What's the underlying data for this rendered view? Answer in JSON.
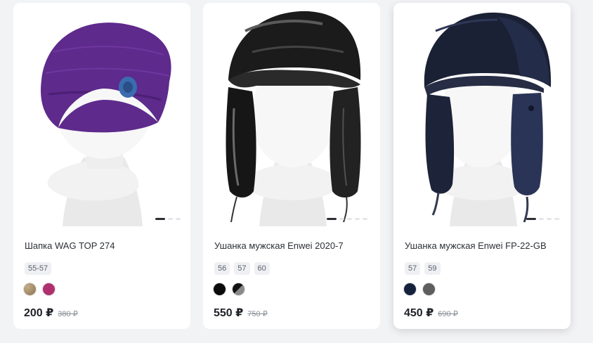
{
  "products": [
    {
      "title": "Шапка WAG TOP 274",
      "sizes": [
        "55-57"
      ],
      "colors": [
        "#a08a66",
        "#b0306e"
      ],
      "price": "200 ₽",
      "old_price": "380 ₽",
      "image_icon": "purple-beanie-icon",
      "slides": 3,
      "active_slide": 1
    },
    {
      "title": "Ушанка мужская Enwei 2020-7",
      "sizes": [
        "56",
        "57",
        "60"
      ],
      "colors": [
        "#0b0b0b",
        "#6e6e6e"
      ],
      "price": "550 ₽",
      "old_price": "750 ₽",
      "image_icon": "black-fur-ushanka-icon",
      "slides": 5,
      "active_slide": 1
    },
    {
      "title": "Ушанка мужская Enwei FP-22-GB",
      "sizes": [
        "57",
        "59"
      ],
      "colors": [
        "#16213d",
        "#5e5e5e"
      ],
      "price": "450 ₽",
      "old_price": "690 ₽",
      "image_icon": "navy-ushanka-icon",
      "slides": 4,
      "active_slide": 1
    }
  ]
}
